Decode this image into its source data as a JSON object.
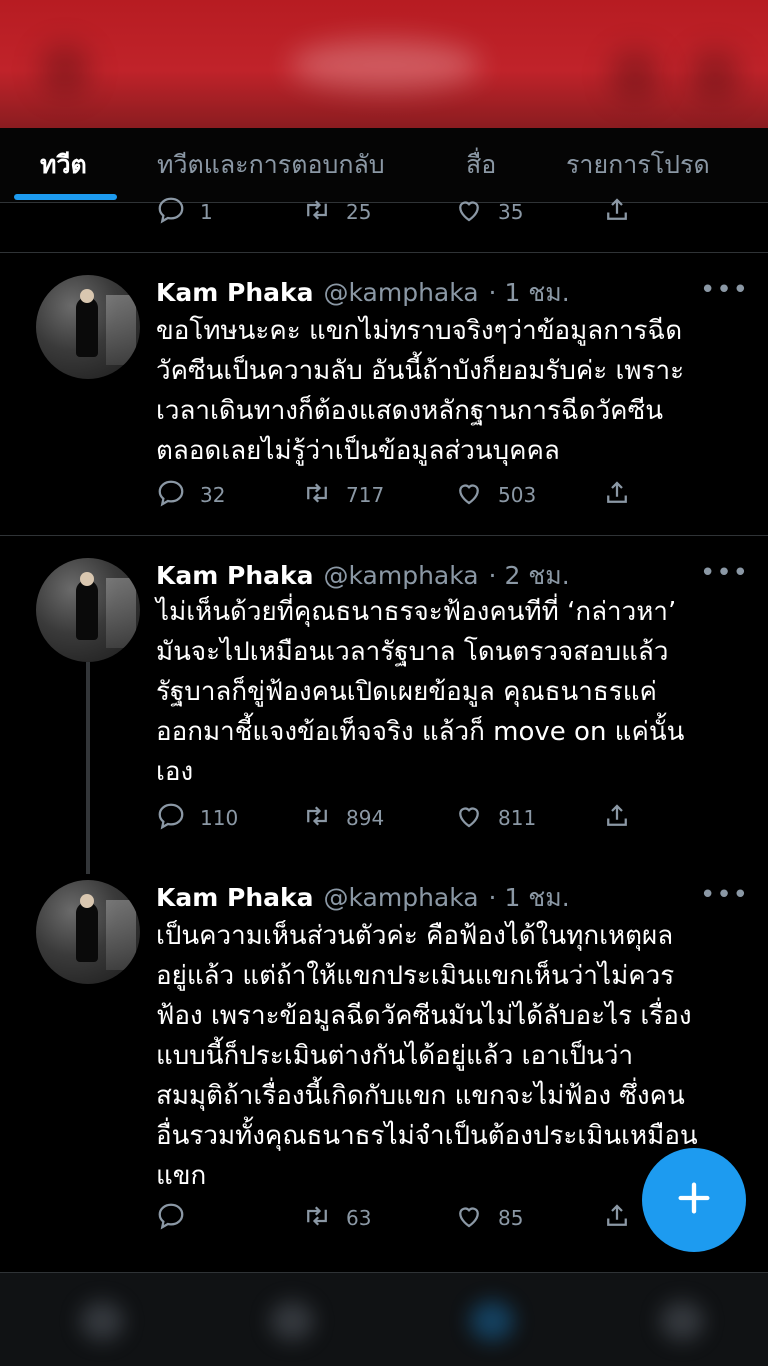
{
  "tabs": [
    {
      "label": "ทวีต",
      "active": true
    },
    {
      "label": "ทวีตและการตอบกลับ",
      "active": false
    },
    {
      "label": "สื่อ",
      "active": false
    },
    {
      "label": "รายการโปรด",
      "active": false
    }
  ],
  "previous_tweet_actions": {
    "replies": "1",
    "retweets": "25",
    "likes": "35"
  },
  "tweets": [
    {
      "name": "Kam Phaka",
      "handle": "@kamphaka",
      "time": "· 1 ชม.",
      "text_lines": [
        "ขอโทษนะคะ แขกไม่ทราบจริงๆว่าข้อมูลการฉีด",
        "วัคซีนเป็นความลับ อันนี้ถ้าบังก็ยอมรับค่ะ เพราะ",
        "เวลาเดินทางก็ต้องแสดงหลักฐานการฉีดวัคซีน",
        "ตลอดเลยไม่รู้ว่าเป็นข้อมูลส่วนบุคคล"
      ],
      "replies": "32",
      "retweets": "717",
      "likes": "503"
    },
    {
      "name": "Kam Phaka",
      "handle": "@kamphaka",
      "time": "· 2 ชม.",
      "text_lines": [
        "ไม่เห็นด้วยที่คุณธนาธรจะฟ้องคนทีที่ ‘กล่าวหา’",
        "มันจะไปเหมือนเวลารัฐบาล โดนตรวจสอบแล้ว",
        "รัฐบาลก็ขู่ฟ้องคนเปิดเผยข้อมูล คุณธนาธรแค่",
        "ออกมาชี้แจงข้อเท็จจริง แล้วก็ move on แค่นั้น",
        "เอง"
      ],
      "replies": "110",
      "retweets": "894",
      "likes": "811"
    },
    {
      "name": "Kam Phaka",
      "handle": "@kamphaka",
      "time": "· 1 ชม.",
      "text_lines": [
        "เป็นความเห็นส่วนตัวค่ะ คือฟ้องได้ในทุกเหตุผล",
        "อยู่แล้ว แต่ถ้าให้แขกประเมินแขกเห็นว่าไม่ควร",
        "ฟ้อง เพราะข้อมูลฉีดวัคซีนมันไม่ได้ลับอะไร เรื่อง",
        "แบบนี้ก็ประเมินต่างกันได้อยู่แล้ว เอาเป็นว่า",
        "สมมุติถ้าเรื่องนี้เกิดกับแขก แขกจะไม่ฟ้อง ซึ่งคน",
        "อื่นรวมทั้งคุณธนาธรไม่จำเป็นต้องประเมินเหมือน",
        "แขก"
      ],
      "replies": "",
      "retweets": "63",
      "likes": "85"
    }
  ],
  "more_label": "•••",
  "icons": {
    "reply": "reply-icon",
    "retweet": "retweet-icon",
    "like": "heart-icon",
    "share": "share-icon",
    "compose": "compose-plus-icon"
  },
  "colors": {
    "accent": "#1d9bf0",
    "banner": "#c0232a",
    "text": "#ffffff",
    "muted": "#8b98a5"
  }
}
